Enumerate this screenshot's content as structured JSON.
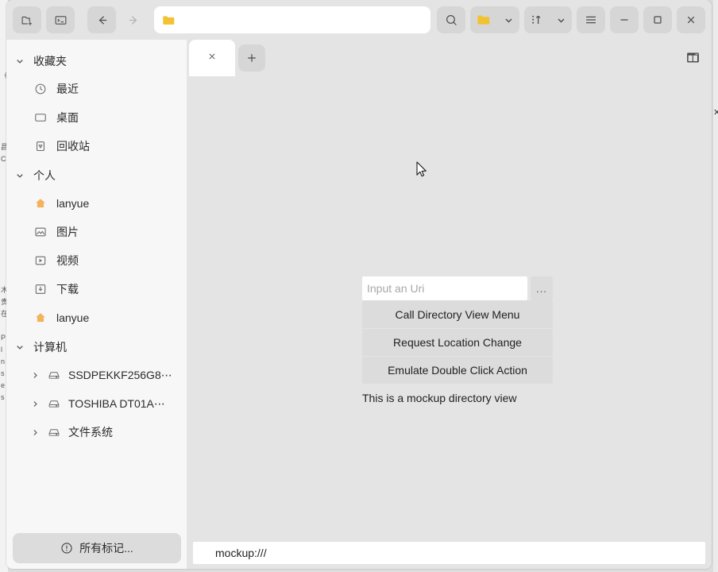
{
  "window": {
    "background_color": "#e4e4e4",
    "sidebar_color": "#f7f7f7"
  },
  "toolbar": {
    "new_folder_icon": "new-folder-icon",
    "terminal_icon": "terminal-icon",
    "back_icon": "arrow-left-icon",
    "forward_icon": "arrow-right-icon",
    "address_icon": "folder-icon",
    "address_value": "",
    "address_placeholder": "",
    "search_icon": "search-icon",
    "view_mode_icon": "folder-icon",
    "view_mode_chevron": "chevron-down-icon",
    "sort_icon": "sort-ascending-icon",
    "sort_chevron": "chevron-down-icon",
    "menu_icon": "hamburger-menu-icon",
    "minimize_icon": "minimize-icon",
    "maximize_icon": "maximize-icon",
    "close_icon": "close-icon"
  },
  "tabs": {
    "items": [
      {
        "label": "",
        "close_icon": "close-icon",
        "active": true
      }
    ],
    "add_label": "+",
    "split_view_icon": "split-view-icon"
  },
  "sidebar": {
    "groups": [
      {
        "title": "收藏夹",
        "chevron": "chevron-down-icon",
        "items": [
          {
            "label": "最近",
            "icon": "clock-icon"
          },
          {
            "label": "桌面",
            "icon": "desktop-icon"
          },
          {
            "label": "回收站",
            "icon": "trash-icon"
          }
        ]
      },
      {
        "title": "个人",
        "chevron": "chevron-down-icon",
        "items": [
          {
            "label": "lanyue",
            "icon": "home-icon"
          },
          {
            "label": "图片",
            "icon": "image-icon"
          },
          {
            "label": "视频",
            "icon": "video-icon"
          },
          {
            "label": "下载",
            "icon": "download-icon"
          },
          {
            "label": "lanyue",
            "icon": "home-icon"
          }
        ]
      },
      {
        "title": "计算机",
        "chevron": "chevron-down-icon",
        "items": [
          {
            "label": "SSDPEKKF256G8⋯",
            "icon": "disk-icon",
            "arrow": "chevron-right-icon"
          },
          {
            "label": "TOSHIBA DT01A⋯",
            "icon": "disk-icon",
            "arrow": "chevron-right-icon"
          },
          {
            "label": "文件系统",
            "icon": "disk-icon",
            "arrow": "chevron-right-icon"
          }
        ]
      }
    ],
    "footer": {
      "label": "所有标记...",
      "icon": "exclamation-circle-icon"
    }
  },
  "mockup": {
    "uri_placeholder": "Input an Uri",
    "uri_value": "",
    "more_button_label": "...",
    "buttons": [
      "Call Directory View Menu",
      "Request Location Change",
      "Emulate Double Click Action"
    ],
    "caption": "This is a mockup directory view"
  },
  "statusbar": {
    "path": "mockup:///"
  },
  "background_window": {
    "left_glyphs": "《 昌 C 言 · 木 贵 在 P l n s e s",
    "right_mark": "x"
  }
}
